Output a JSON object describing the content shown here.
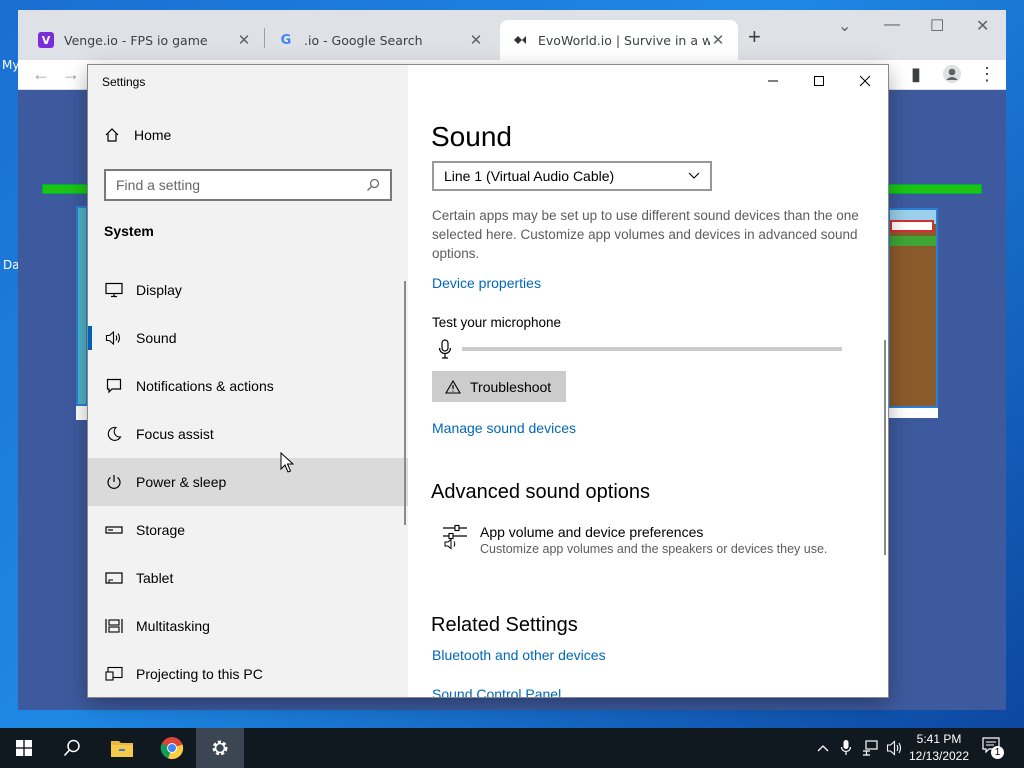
{
  "desktop": {
    "icon_label_1": "My",
    "icon_label_2": "Da"
  },
  "browser": {
    "tabs": [
      {
        "title": "Venge.io - FPS io game",
        "favicon_color": "#7b2cd9",
        "favicon_letter": "V"
      },
      {
        "title": ".io - Google Search",
        "favicon_color": "#ffffff",
        "favicon_letter": "G"
      },
      {
        "title": "EvoWorld.io | Survive in a world",
        "favicon_color": "#ffffff",
        "favicon_letter": ""
      }
    ],
    "new_tab_label": "+"
  },
  "settings": {
    "window_title": "Settings",
    "home_label": "Home",
    "search_placeholder": "Find a setting",
    "section_label": "System",
    "nav_items": [
      {
        "label": "Display",
        "icon": "monitor-icon"
      },
      {
        "label": "Sound",
        "icon": "speaker-icon"
      },
      {
        "label": "Notifications & actions",
        "icon": "notification-icon"
      },
      {
        "label": "Focus assist",
        "icon": "moon-icon"
      },
      {
        "label": "Power & sleep",
        "icon": "power-icon"
      },
      {
        "label": "Storage",
        "icon": "storage-icon"
      },
      {
        "label": "Tablet",
        "icon": "tablet-icon"
      },
      {
        "label": "Multitasking",
        "icon": "multitasking-icon"
      },
      {
        "label": "Projecting to this PC",
        "icon": "projector-icon"
      }
    ],
    "content": {
      "title": "Sound",
      "device_selected": "Line 1 (Virtual Audio Cable)",
      "description": "Certain apps may be set up to use different sound devices than the one selected here. Customize app volumes and devices in advanced sound options.",
      "device_properties_link": "Device properties",
      "test_mic_label": "Test your microphone",
      "mic_level": 0,
      "troubleshoot_label": "Troubleshoot",
      "manage_devices_link": "Manage sound devices",
      "advanced_heading": "Advanced sound options",
      "app_volume_title": "App volume and device preferences",
      "app_volume_desc": "Customize app volumes and the speakers or devices they use.",
      "related_heading": "Related Settings",
      "bluetooth_link": "Bluetooth and other devices",
      "sound_cp_link": "Sound Control Panel"
    }
  },
  "taskbar": {
    "time": "5:41 PM",
    "date": "12/13/2022",
    "notification_count": "1"
  },
  "colors": {
    "accent": "#0063b1",
    "link": "#0067b8",
    "taskbar": "#101820"
  }
}
